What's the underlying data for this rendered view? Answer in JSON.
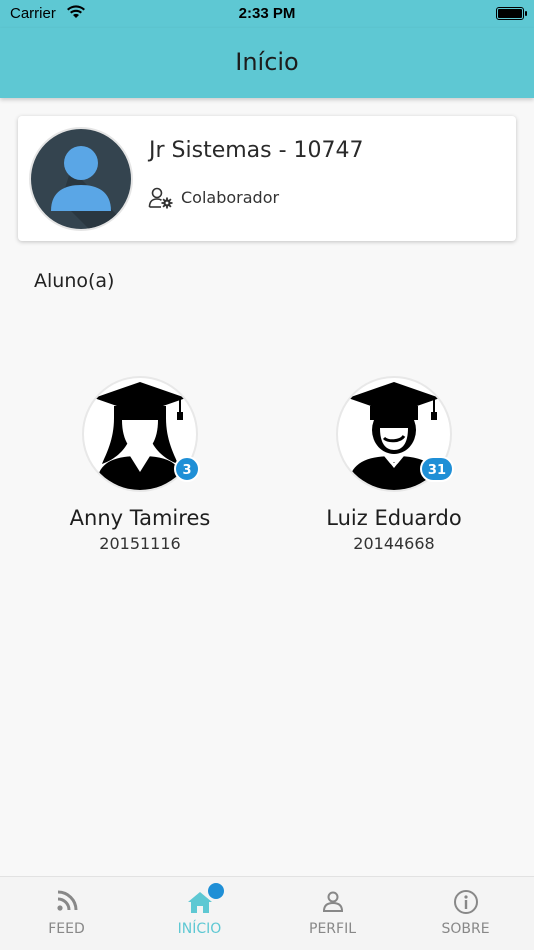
{
  "status_bar": {
    "carrier": "Carrier",
    "time": "2:33 PM"
  },
  "header": {
    "title": "Início"
  },
  "profile": {
    "name": "Jr Sistemas - 10747",
    "role": "Colaborador"
  },
  "section": {
    "title": "Aluno(a)"
  },
  "students": [
    {
      "name": "Anny Tamires",
      "id": "20151116",
      "badge": "3",
      "icon": "graduate-female-icon"
    },
    {
      "name": "Luiz Eduardo",
      "id": "20144668",
      "badge": "31",
      "icon": "graduate-male-icon"
    }
  ],
  "tabs": [
    {
      "label": "FEED",
      "icon": "rss-icon"
    },
    {
      "label": "INÍCIO",
      "icon": "home-icon",
      "active": true
    },
    {
      "label": "PERFIL",
      "icon": "user-icon"
    },
    {
      "label": "SOBRE",
      "icon": "info-icon"
    }
  ],
  "colors": {
    "accent": "#5ec8d3",
    "badge": "#1f8fd6",
    "avatar_bg": "#34444f",
    "avatar_fg": "#5aa6e6"
  }
}
